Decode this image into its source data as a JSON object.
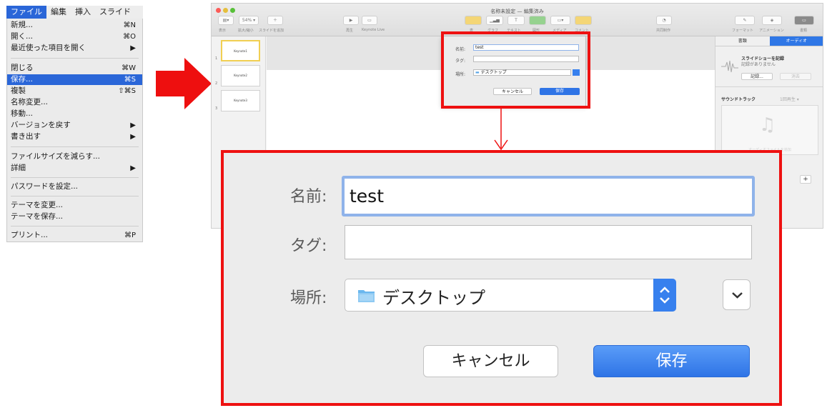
{
  "file_menu": {
    "menubar": [
      "ファイル",
      "編集",
      "挿入",
      "スライド"
    ],
    "items": [
      {
        "label": "新規...",
        "shortcut": "⌘N"
      },
      {
        "label": "開く...",
        "shortcut": "⌘O"
      },
      {
        "label": "最近使った項目を開く",
        "shortcut": "▶"
      },
      {
        "label": "閉じる",
        "shortcut": "⌘W"
      },
      {
        "label": "保存...",
        "shortcut": "⌘S"
      },
      {
        "label": "複製",
        "shortcut": "⇧⌘S"
      },
      {
        "label": "名称変更...",
        "shortcut": ""
      },
      {
        "label": "移動...",
        "shortcut": ""
      },
      {
        "label": "バージョンを戻す",
        "shortcut": "▶"
      },
      {
        "label": "書き出す",
        "shortcut": "▶"
      },
      {
        "label": "ファイルサイズを減らす...",
        "shortcut": ""
      },
      {
        "label": "詳細",
        "shortcut": "▶"
      },
      {
        "label": "パスワードを設定...",
        "shortcut": ""
      },
      {
        "label": "テーマを変更...",
        "shortcut": ""
      },
      {
        "label": "テーマを保存...",
        "shortcut": ""
      },
      {
        "label": "プリント...",
        "shortcut": "⌘P"
      }
    ]
  },
  "keynote": {
    "window_title": "名称未設定 — 編集済み",
    "zoom_value": "54%",
    "toolbar_labels": [
      "表示",
      "拡大/縮小",
      "スライドを追加",
      "再生",
      "Keynote Live",
      "表",
      "グラフ",
      "テキスト",
      "図形",
      "メディア",
      "コメント",
      "共同制作",
      "フォーマット",
      "アニメーション",
      "書類"
    ],
    "slides": [
      {
        "num": "1",
        "title": "Keynote1"
      },
      {
        "num": "2",
        "title": "Keynote2"
      },
      {
        "num": "3",
        "title": "Keynote3"
      }
    ],
    "inspector": {
      "tabs": [
        "書類",
        "オーディオ"
      ],
      "record_title": "スライドショーを記録",
      "record_status": "記録がありません",
      "record_button": "記録...",
      "clear_button": "消去",
      "soundtrack_label": "サウンドトラック",
      "soundtrack_value": "1回再生",
      "audio_placeholder": "オーディオファイルを追加"
    }
  },
  "save_dialog": {
    "name_label": "名前:",
    "name_value": "test",
    "tag_label": "タグ:",
    "tag_value": "",
    "location_label": "場所:",
    "location_value": "デスクトップ",
    "cancel_label": "キャンセル",
    "save_label": "保存"
  },
  "colors": {
    "highlight_red": "#ee1111",
    "menu_selection": "#2a66d8",
    "save_button": "#2f74e6"
  }
}
